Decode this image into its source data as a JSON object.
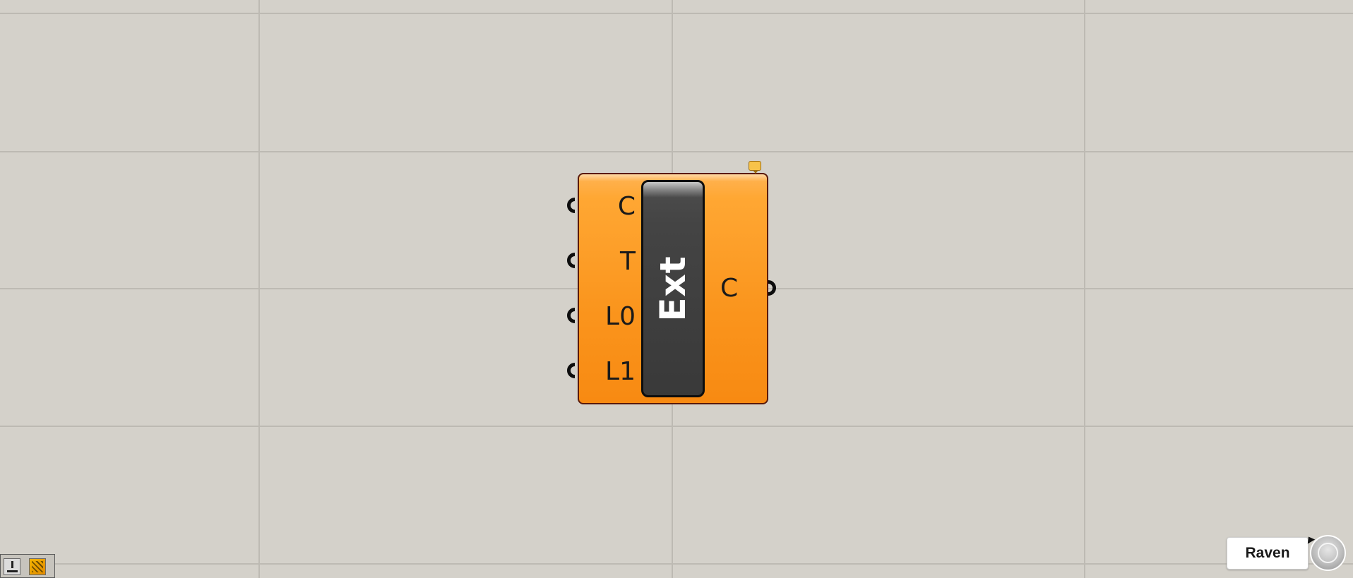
{
  "component": {
    "nickname": "Ext",
    "inputs": [
      {
        "label": "C"
      },
      {
        "label": "T"
      },
      {
        "label": "L0"
      },
      {
        "label": "L1"
      }
    ],
    "outputs": [
      {
        "label": "C"
      }
    ],
    "colors": {
      "body": "#f88a12",
      "body_highlight": "#ffb04a",
      "border": "#5a1a0a",
      "pill": "#393939",
      "text": "#1a1a1a",
      "pill_text": "#ffffff"
    }
  },
  "canvas": {
    "background": "#d4d1ca",
    "grid_color": "#bdbab3"
  },
  "status_bar": {
    "icons": [
      "download-icon",
      "grasshopper-icon"
    ]
  },
  "raven": {
    "label": "Raven"
  }
}
